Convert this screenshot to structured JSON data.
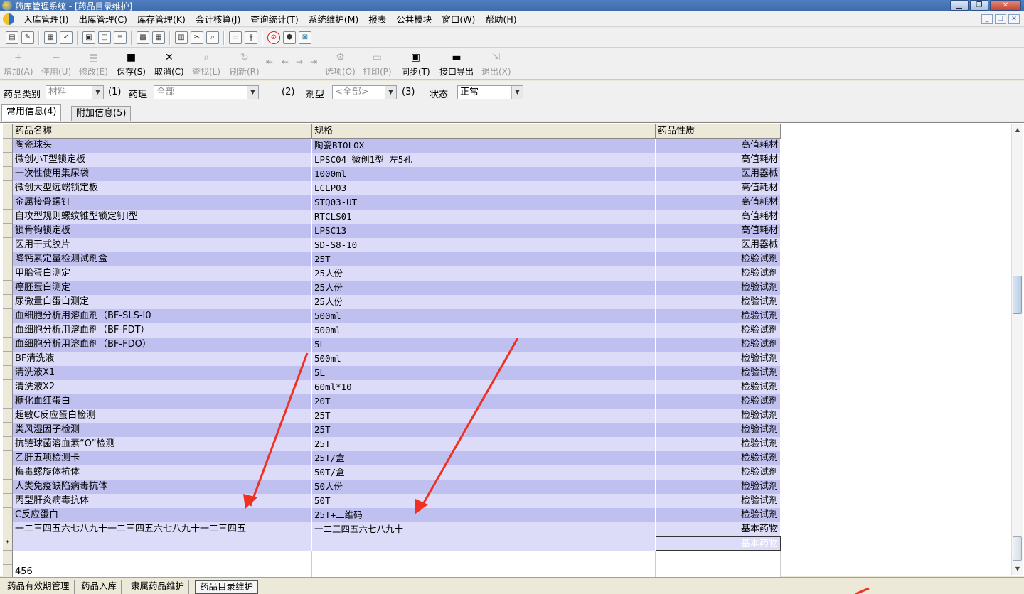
{
  "window": {
    "title": "药库管理系统 - [药品目录维护]"
  },
  "menu": [
    "入库管理(I)",
    "出库管理(C)",
    "库存管理(K)",
    "会计核算(J)",
    "查询统计(T)",
    "系统维护(M)",
    "报表",
    "公共模块",
    "窗口(W)",
    "帮助(H)"
  ],
  "toolbar2": {
    "add": "增加(A)",
    "stop": "停用(U)",
    "edit": "修改(E)",
    "save": "保存(S)",
    "cancel": "取消(C)",
    "find": "查找(L)",
    "refresh": "刷新(R)",
    "options": "选项(O)",
    "print": "打印(P)",
    "sync": "同步(T)",
    "export": "接口导出",
    "exit": "退出(X)"
  },
  "filters": {
    "category_label": "药品类别",
    "category_value": "材料",
    "hint1": "(1)",
    "pharma_label": "药理",
    "pharma_value": "全部",
    "hint2": "(2)",
    "form_label": "剂型",
    "form_value": "<全部>",
    "hint3": "(3)",
    "status_label": "状态",
    "status_value": "正常"
  },
  "tabs": {
    "common": "常用信息(4)",
    "extra": "附加信息(5)"
  },
  "grid": {
    "headers": {
      "name": "药品名称",
      "spec": "规格",
      "prop": "药品性质"
    },
    "rows": [
      {
        "name": "陶瓷球头",
        "spec": "陶瓷BIOLOX",
        "prop": "高值耗材"
      },
      {
        "name": "微创小T型锁定板",
        "spec": "LPSC04 微创1型 左5孔",
        "prop": "高值耗材"
      },
      {
        "name": "一次性使用集尿袋",
        "spec": "1000ml",
        "prop": "医用器械"
      },
      {
        "name": "微创大型远端锁定板",
        "spec": "LCLP03",
        "prop": "高值耗材"
      },
      {
        "name": "金属接骨螺钉",
        "spec": "STQ03-UT",
        "prop": "高值耗材"
      },
      {
        "name": "自攻型规则螺纹锥型锁定钉Ⅰ型",
        "spec": "RTCLS01",
        "prop": "高值耗材"
      },
      {
        "name": "锁骨钩锁定板",
        "spec": "LPSC13",
        "prop": "高值耗材"
      },
      {
        "name": "医用干式胶片",
        "spec": "SD-S8-10",
        "prop": "医用器械"
      },
      {
        "name": "降钙素定量检测试剂盒",
        "spec": "25T",
        "prop": "检验试剂"
      },
      {
        "name": "甲胎蛋白测定",
        "spec": "25人份",
        "prop": "检验试剂"
      },
      {
        "name": "癌胚蛋白测定",
        "spec": "25人份",
        "prop": "检验试剂"
      },
      {
        "name": "尿微量白蛋白测定",
        "spec": "25人份",
        "prop": "检验试剂"
      },
      {
        "name": "血细胞分析用溶血剂（BF-SLS-I0",
        "spec": "500ml",
        "prop": "检验试剂"
      },
      {
        "name": "血细胞分析用溶血剂（BF-FDT）",
        "spec": "500ml",
        "prop": "检验试剂"
      },
      {
        "name": "血细胞分析用溶血剂（BF-FDO）",
        "spec": "5L",
        "prop": "检验试剂"
      },
      {
        "name": "BF清洗液",
        "spec": "500ml",
        "prop": "检验试剂"
      },
      {
        "name": "清洗液X1",
        "spec": "5L",
        "prop": "检验试剂"
      },
      {
        "name": "清洗液X2",
        "spec": "60ml*10",
        "prop": "检验试剂"
      },
      {
        "name": "糖化血红蛋白",
        "spec": "20T",
        "prop": "检验试剂"
      },
      {
        "name": "超敏C反应蛋白检测",
        "spec": "25T",
        "prop": "检验试剂"
      },
      {
        "name": "类风湿因子检测",
        "spec": "25T",
        "prop": "检验试剂"
      },
      {
        "name": "抗链球菌溶血素“O”检测",
        "spec": "25T",
        "prop": "检验试剂"
      },
      {
        "name": "乙肝五项检测卡",
        "spec": "25T/盒",
        "prop": "检验试剂"
      },
      {
        "name": "梅毒螺旋体抗体",
        "spec": "50T/盒",
        "prop": "检验试剂"
      },
      {
        "name": "人类免疫缺陷病毒抗体",
        "spec": "50人份",
        "prop": "检验试剂"
      },
      {
        "name": "丙型肝炎病毒抗体",
        "spec": "50T",
        "prop": "检验试剂"
      },
      {
        "name": "C反应蛋白",
        "spec": "25T+二维码",
        "prop": "检验试剂"
      },
      {
        "name": "一二三四五六七八九十一二三四五六七八九十一二三四五",
        "spec": "一二三四五六七八九十",
        "prop": "基本药物"
      }
    ],
    "new_row_marker": "*",
    "new_row_prop": "基本药物",
    "total": "456"
  },
  "taskbar": [
    "药品有效期管理",
    "药品入库",
    "隶属药品维护",
    "药品目录维护"
  ],
  "colors": {
    "row_odd": "#C0C0F0",
    "row_even": "#DCDCF8",
    "arrow": "#F03020",
    "titlebar": "#3E6BAA"
  }
}
